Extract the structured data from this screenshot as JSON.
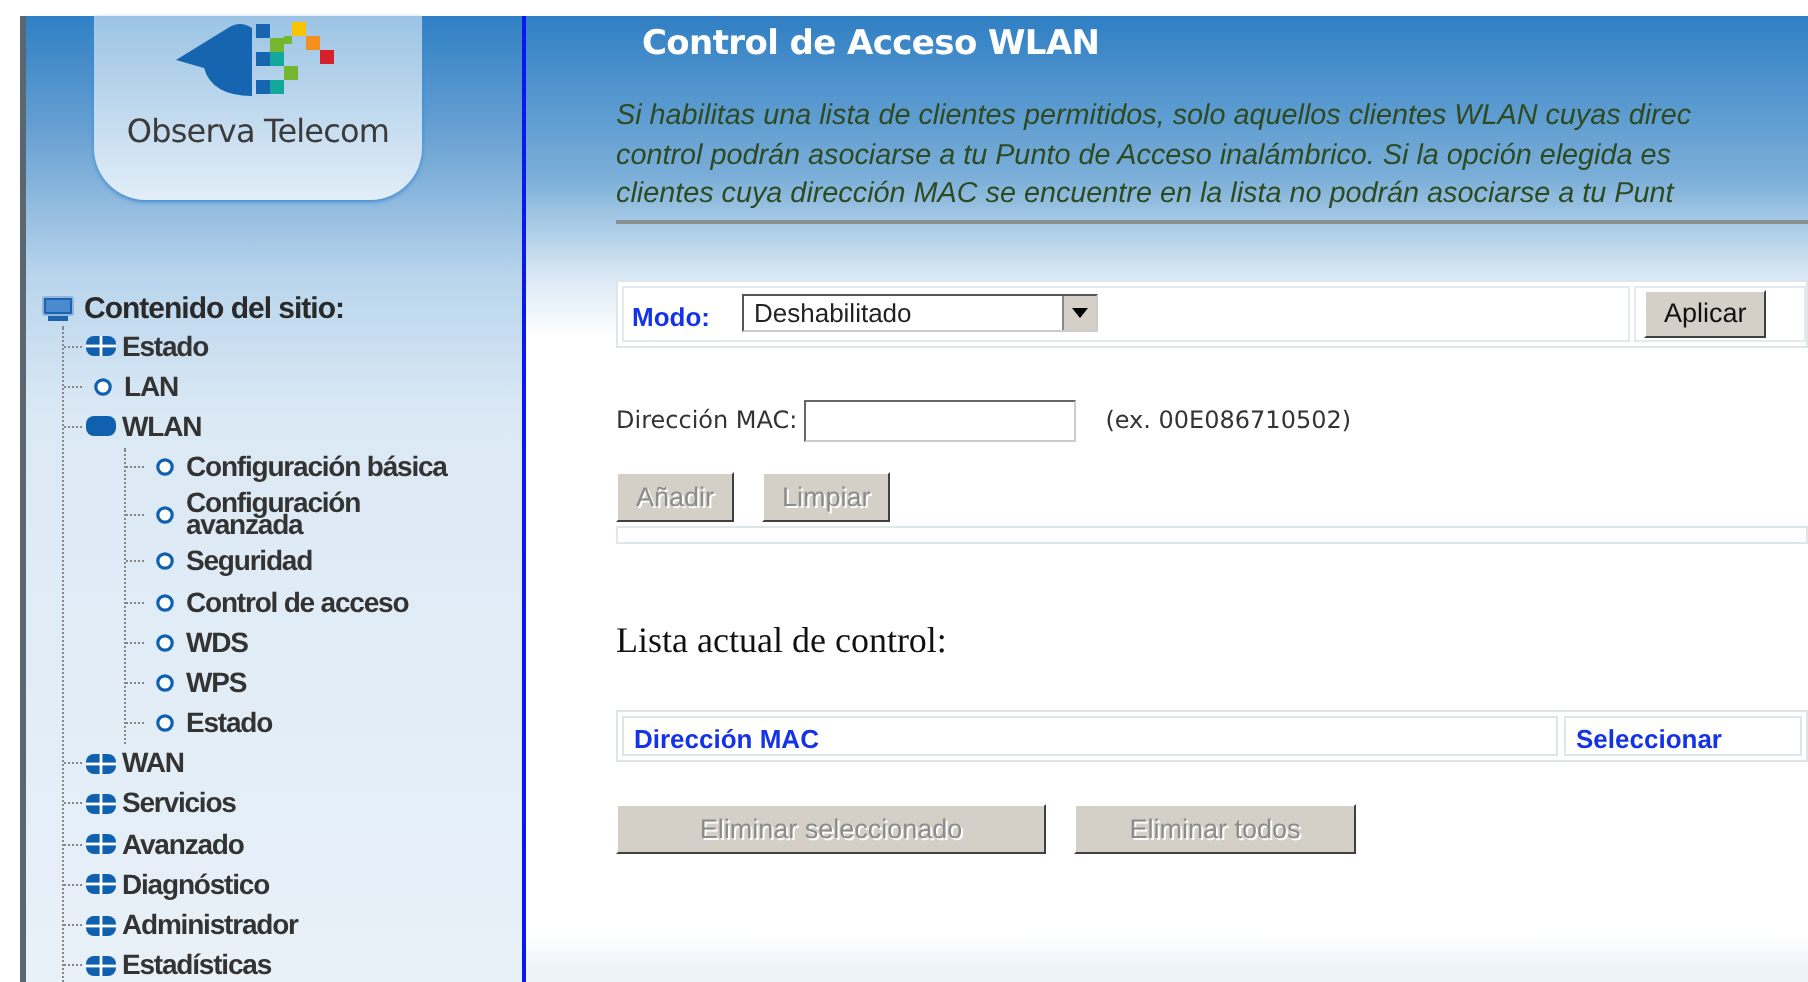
{
  "logo": {
    "text": "Observa Telecom"
  },
  "sidebar": {
    "heading": "Contenido del sitio:",
    "items": [
      {
        "label": "Estado",
        "kind": "folder",
        "expanded": false
      },
      {
        "label": "LAN",
        "kind": "page"
      },
      {
        "label": "WLAN",
        "kind": "folder",
        "expanded": true,
        "children": [
          {
            "label": "Configuración básica",
            "kind": "page"
          },
          {
            "label": "Configuración avanzada",
            "kind": "page"
          },
          {
            "label": "Seguridad",
            "kind": "page"
          },
          {
            "label": "Control de acceso",
            "kind": "page"
          },
          {
            "label": "WDS",
            "kind": "page"
          },
          {
            "label": "WPS",
            "kind": "page"
          },
          {
            "label": "Estado",
            "kind": "page"
          }
        ]
      },
      {
        "label": "WAN",
        "kind": "folder",
        "expanded": false
      },
      {
        "label": "Servicios",
        "kind": "folder",
        "expanded": false
      },
      {
        "label": "Avanzado",
        "kind": "folder",
        "expanded": false
      },
      {
        "label": "Diagnóstico",
        "kind": "folder",
        "expanded": false
      },
      {
        "label": "Administrador",
        "kind": "folder",
        "expanded": false
      },
      {
        "label": "Estadísticas",
        "kind": "folder",
        "expanded": false
      }
    ]
  },
  "page": {
    "title": "Control de Acceso WLAN",
    "description": [
      "Si habilitas una lista de clientes permitidos, solo aquellos clientes WLAN cuyas direc",
      "control podrán asociarse a tu Punto de Acceso inalámbrico. Si la opción elegida es",
      "clientes cuya dirección MAC se encuentre en la lista no podrán asociarse a tu Punt"
    ],
    "mode": {
      "label": "Modo:",
      "value": "Deshabilitado"
    },
    "apply_button": {
      "label": "Aplicar",
      "disabled": false
    },
    "mac": {
      "label": "Dirección MAC:",
      "hint": "(ex. 00E086710502)"
    },
    "mac_buttons": [
      {
        "label": "Añadir",
        "disabled": true
      },
      {
        "label": "Limpiar",
        "disabled": true
      }
    ],
    "list_title": "Lista actual de control:",
    "table": {
      "columns": [
        "Dirección MAC",
        "Seleccionar"
      ]
    },
    "list_buttons": [
      {
        "label": "Eliminar seleccionado",
        "disabled": true
      },
      {
        "label": "Eliminar todos",
        "disabled": true
      }
    ]
  }
}
